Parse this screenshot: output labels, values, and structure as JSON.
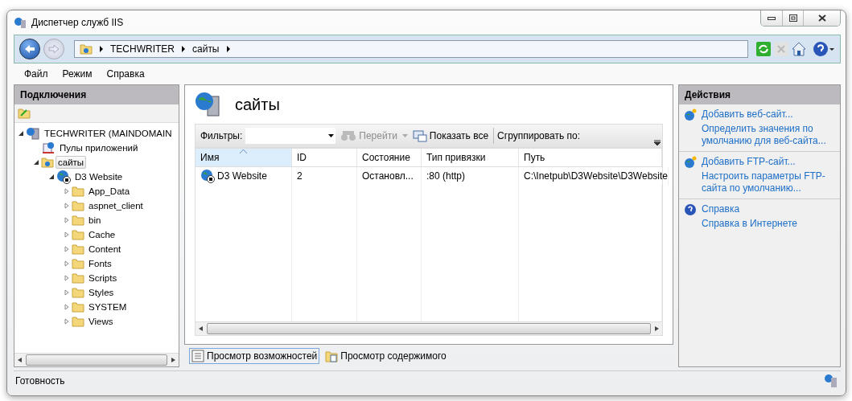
{
  "window": {
    "title": "Диспетчер служб IIS"
  },
  "breadcrumb": [
    "TECHWRITER",
    "сайты"
  ],
  "menu": [
    "Файл",
    "Режим",
    "Справка"
  ],
  "connections": {
    "title": "Подключения",
    "tree": [
      {
        "label": "TECHWRITER (MAINDOMAIN",
        "kind": "server",
        "expanded": true,
        "selected": false,
        "children": [
          {
            "label": "Пулы приложений",
            "kind": "pools",
            "selected": false
          },
          {
            "label": "сайты",
            "kind": "sites",
            "expanded": true,
            "selected": true,
            "children": [
              {
                "label": "D3 Website",
                "kind": "website",
                "expanded": true,
                "selected": false,
                "children": [
                  {
                    "label": "App_Data",
                    "kind": "folder",
                    "expanded": false,
                    "selected": false
                  },
                  {
                    "label": "aspnet_client",
                    "kind": "folder",
                    "expanded": false,
                    "selected": false
                  },
                  {
                    "label": "bin",
                    "kind": "folder",
                    "expanded": false,
                    "selected": false
                  },
                  {
                    "label": "Cache",
                    "kind": "folder",
                    "expanded": false,
                    "selected": false
                  },
                  {
                    "label": "Content",
                    "kind": "folder",
                    "expanded": false,
                    "selected": false
                  },
                  {
                    "label": "Fonts",
                    "kind": "folder",
                    "expanded": false,
                    "selected": false
                  },
                  {
                    "label": "Scripts",
                    "kind": "folder",
                    "expanded": false,
                    "selected": false
                  },
                  {
                    "label": "Styles",
                    "kind": "folder",
                    "expanded": false,
                    "selected": false
                  },
                  {
                    "label": "SYSTEM",
                    "kind": "folder",
                    "expanded": false,
                    "selected": false
                  },
                  {
                    "label": "Views",
                    "kind": "folder",
                    "expanded": false,
                    "selected": false
                  }
                ]
              }
            ]
          }
        ]
      }
    ]
  },
  "content": {
    "title": "сайты",
    "filter_label": "Фильтры:",
    "go_button": {
      "label": "Перейти",
      "disabled": true
    },
    "show_all": "Показать все",
    "group_by": "Сгруппировать по:",
    "table": {
      "columns": [
        {
          "label": "Имя",
          "sorted": true
        },
        {
          "label": "ID",
          "sorted": false
        },
        {
          "label": "Состояние",
          "sorted": false
        },
        {
          "label": "Тип привязки",
          "sorted": false
        },
        {
          "label": "Путь",
          "sorted": false
        }
      ],
      "rows": [
        [
          "D3 Website",
          "2",
          "Остановл...",
          ":80 (http)",
          "C:\\Inetpub\\D3Website\\D3Website"
        ]
      ]
    }
  },
  "view_tabs": [
    {
      "label": "Просмотр возможностей",
      "selected": true
    },
    {
      "label": "Просмотр содержимого",
      "selected": false
    }
  ],
  "actions": {
    "title": "Действия",
    "groups": [
      {
        "kind": "add",
        "items": [
          "Добавить веб-сайт...",
          "Определить значения по умолчанию для веб-сайта..."
        ]
      },
      {
        "kind": "add",
        "items": [
          "Добавить FTP-сайт...",
          "Настроить параметры FTP-сайта по умолчанию..."
        ]
      },
      {
        "kind": "help",
        "items": [
          "Справка",
          "Справка в Интернете"
        ]
      }
    ]
  },
  "status_bar": {
    "text": "Готовность"
  }
}
